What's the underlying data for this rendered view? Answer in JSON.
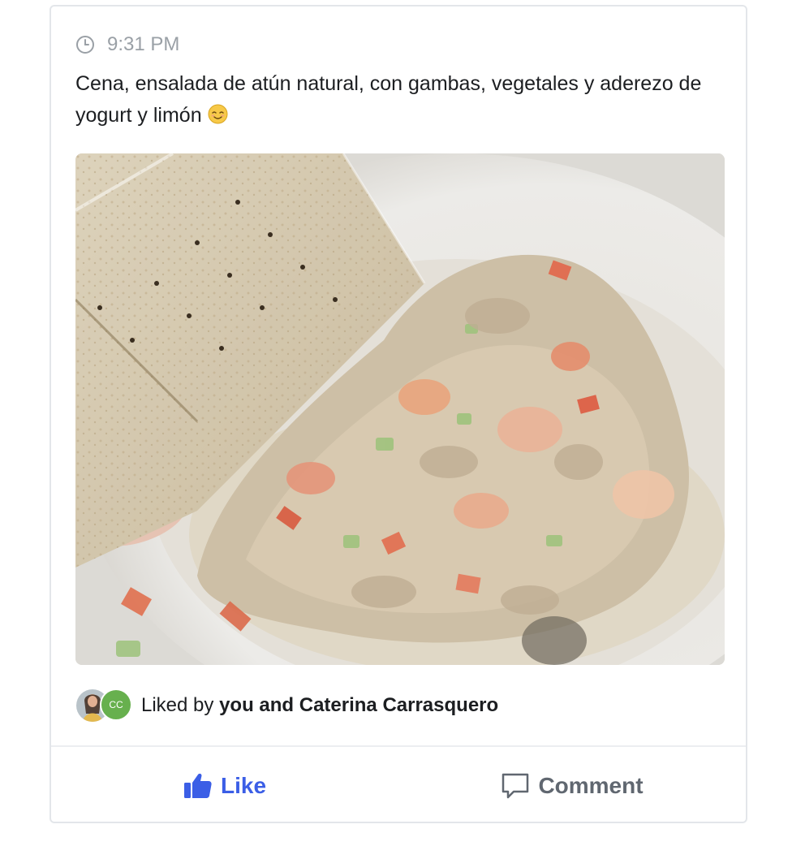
{
  "post": {
    "time": "9:31 PM",
    "text": "Cena, ensalada de atún natural, con gambas, vegetales y aderezo de yogurt y limón",
    "emoji": "relieved-face-icon",
    "photo": "food-photo-tuna-salad"
  },
  "likes": {
    "prefix": "Liked by ",
    "names": "you and Caterina Carrasquero",
    "avatars": [
      {
        "type": "photo",
        "name": "avatar-photo"
      },
      {
        "type": "initials",
        "initials": "CC",
        "color": "#67b04e"
      }
    ]
  },
  "actions": {
    "like_label": "Like",
    "comment_label": "Comment"
  },
  "colors": {
    "accent": "#3b5ee6",
    "muted": "#9aa0a6",
    "text": "#1c1e21"
  }
}
